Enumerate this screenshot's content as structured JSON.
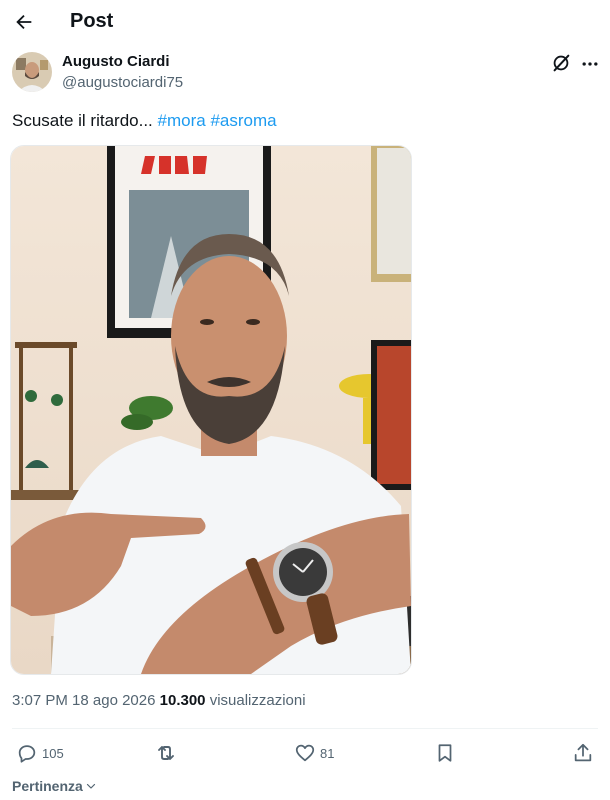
{
  "header": {
    "title": "Post",
    "back_icon": "arrow-left-icon"
  },
  "author": {
    "name": "Augusto Ciardi",
    "handle": "@augustociardi75"
  },
  "tweet": {
    "text": "Scusate il ritardo...",
    "hashtags": [
      "#mora",
      "#asroma"
    ],
    "hashtag_color": "#1d9bf0"
  },
  "meta": {
    "time": "3:07 PM",
    "date": "18 ago 2026",
    "views": "10.300",
    "views_label": "visualizzazioni"
  },
  "actions": {
    "replies": "105",
    "likes": "81",
    "reply_icon": "comment-icon",
    "retweet_icon": "retweet-icon",
    "like_icon": "heart-icon",
    "bookmark_icon": "bookmark-icon",
    "share_icon": "share-icon"
  },
  "sort": {
    "label": "Pertinenza"
  }
}
